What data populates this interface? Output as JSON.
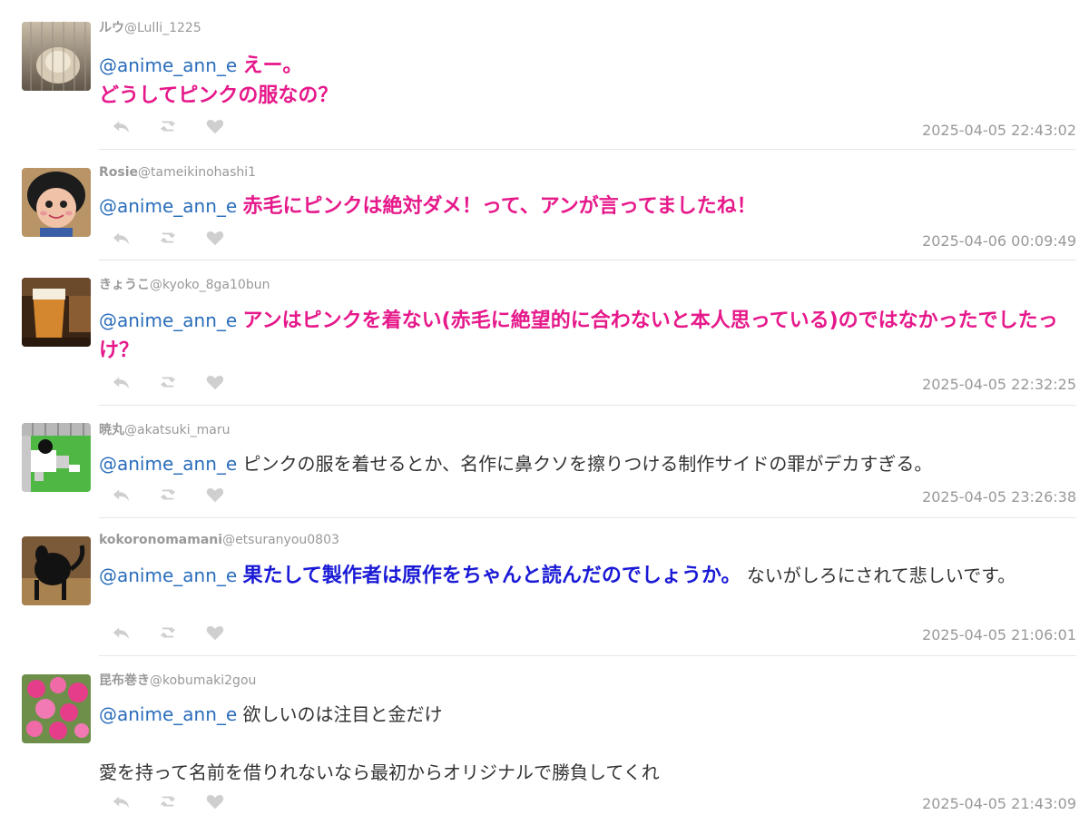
{
  "tweets": [
    {
      "name": "ルウ",
      "handle": "@Lulli_1225",
      "mention": "@anime_ann_e",
      "body": "えー。\nどうしてピンクの服なの？",
      "style": "pink",
      "extra": "",
      "time": "2025-04-05 22:43:02"
    },
    {
      "name": "Rosie",
      "handle": "@tameikinohashi1",
      "mention": "@anime_ann_e",
      "body": "赤毛にピンクは絶対ダメ！って、アンが言ってましたね！",
      "style": "pink",
      "extra": "",
      "time": "2025-04-06 00:09:49"
    },
    {
      "name": "きょうこ",
      "handle": "@kyoko_8ga10bun",
      "mention": "@anime_ann_e",
      "body": "アンはピンクを着ない(赤毛に絶望的に合わないと本人思っている)のではなかったでしたっけ？",
      "style": "pink",
      "extra": "",
      "time": "2025-04-05 22:32:25"
    },
    {
      "name": "暁丸",
      "handle": "@akatsuki_maru",
      "mention": "@anime_ann_e",
      "body": "ピンクの服を着せるとか、名作に鼻クソを擦りつける制作サイドの罪がデカすぎる。",
      "style": "plain",
      "extra": "",
      "time": "2025-04-05 23:26:38"
    },
    {
      "name": "kokoronomamani",
      "handle": "@etsuranyou0803",
      "mention": "@anime_ann_e",
      "body": "果たして製作者は原作をちゃんと読んだのでしょうか。",
      "style": "blue",
      "extra": "ないがしろにされて悲しいです。",
      "time": "2025-04-05 21:06:01"
    },
    {
      "name": "昆布巻き",
      "handle": "@kobumaki2gou",
      "mention": "@anime_ann_e",
      "body": "欲しいのは注目と金だけ\n\n愛を持って名前を借りれないなら最初からオリジナルで勝負してくれ",
      "style": "plain",
      "extra": "",
      "time": "2025-04-05 21:43:09"
    }
  ],
  "icons": {
    "reply": "reply-icon",
    "retweet": "retweet-icon",
    "like": "heart-icon"
  },
  "colors": {
    "mention": "#2a6dbb",
    "pink_text": "#e6198b",
    "blue_text": "#1a1ad6",
    "meta_gray": "#999999",
    "icon_gray": "#cccccc"
  }
}
